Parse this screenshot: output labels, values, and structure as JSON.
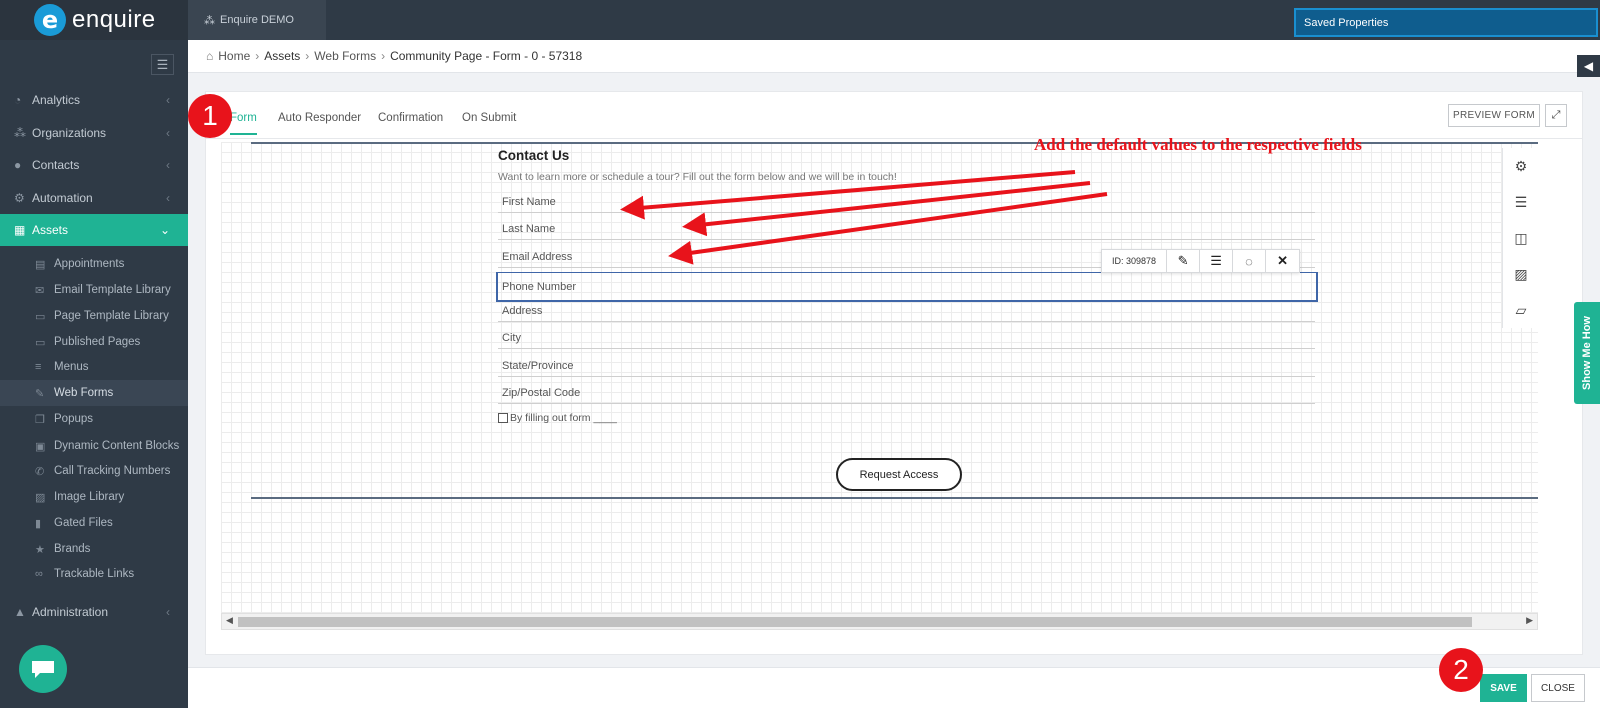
{
  "brand": {
    "logo_letter": "e",
    "name": "enquire"
  },
  "account": {
    "label": "Enquire DEMO"
  },
  "saved_properties": "Saved Properties",
  "sidebar": {
    "items": [
      {
        "label": "Analytics",
        "icon": "dashboard-icon"
      },
      {
        "label": "Organizations",
        "icon": "sitemap-icon"
      },
      {
        "label": "Contacts",
        "icon": "users-icon"
      },
      {
        "label": "Automation",
        "icon": "cogs-icon"
      },
      {
        "label": "Assets",
        "icon": "grid-icon"
      }
    ],
    "sub_items": [
      {
        "label": "Appointments",
        "icon": "calendar-icon"
      },
      {
        "label": "Email Template Library",
        "icon": "envelope-icon"
      },
      {
        "label": "Page Template Library",
        "icon": "page-icon"
      },
      {
        "label": "Published Pages",
        "icon": "page-icon"
      },
      {
        "label": "Menus",
        "icon": "list-icon"
      },
      {
        "label": "Web Forms",
        "icon": "edit-icon"
      },
      {
        "label": "Popups",
        "icon": "popup-icon"
      },
      {
        "label": "Dynamic Content Blocks",
        "icon": "blocks-icon"
      },
      {
        "label": "Call Tracking Numbers",
        "icon": "phone-icon"
      },
      {
        "label": "Image Library",
        "icon": "image-icon"
      },
      {
        "label": "Gated Files",
        "icon": "file-icon"
      },
      {
        "label": "Brands",
        "icon": "star-icon"
      },
      {
        "label": "Trackable Links",
        "icon": "link-icon"
      }
    ],
    "admin": {
      "label": "Administration",
      "icon": "lock-icon"
    }
  },
  "breadcrumb": {
    "home": "Home",
    "assets": "Assets",
    "web_forms": "Web Forms",
    "current": "Community Page - Form - 0 - 57318"
  },
  "tabs": [
    "Form",
    "Auto Responder",
    "Confirmation",
    "On Submit"
  ],
  "preview_label": "PREVIEW FORM",
  "form": {
    "title": "Contact Us",
    "intro": "Want to learn more or schedule a tour? Fill out the form below and we will be in touch!",
    "fields": [
      "First Name",
      "Last Name",
      "Email Address",
      "Phone Number",
      "Address",
      "City",
      "State/Province",
      "Zip/Postal Code"
    ],
    "consent": "By filling out form ____",
    "button": "Request Access"
  },
  "field_toolbar": {
    "id_label": "ID: 309878"
  },
  "show_me_how": "Show Me How",
  "footer": {
    "save": "SAVE",
    "close": "CLOSE"
  },
  "annotations": {
    "note": "Add the default values to the respective fields",
    "step1": "1",
    "step2": "2",
    "color": "#e8131b"
  },
  "colors": {
    "accent": "#1fb394",
    "sidebar": "#2f3a46",
    "saved_properties": "#0f5d8e"
  }
}
